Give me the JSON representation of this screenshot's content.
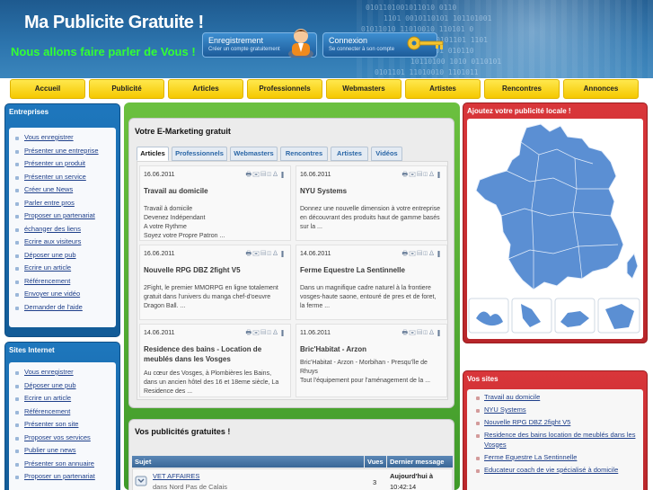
{
  "header": {
    "site_title": "Ma Publicite Gratuite !",
    "tagline": "Nous allons faire parler de Vous !",
    "register_button": {
      "label": "Enregistrement",
      "sub": "Créer un compte gratuitement"
    },
    "login_button": {
      "label": "Connexion",
      "sub": "Se connecter à son compte"
    }
  },
  "nav": [
    "Accueil",
    "Publicité",
    "Articles",
    "Professionnels",
    "Webmasters",
    "Artistes",
    "Rencontres",
    "Annonces"
  ],
  "left": {
    "entreprises": {
      "title": "Entreprises",
      "links": [
        "Vous enregistrer",
        "Présenter une entreprise",
        "Présenter un produit",
        "Présenter un service",
        "Créer une News",
        "Parler entre pros",
        "Proposer un partenariat",
        "échanger des liens",
        "Ecrire aux visiteurs",
        "Déposer une pub",
        "Ecrire un article",
        "Référencement",
        "Envoyer une vidéo",
        "Demander de l'aide"
      ]
    },
    "sites_internet": {
      "title": "Sites Internet",
      "links": [
        "Vous enregistrer",
        "Déposer une pub",
        "Ecrire un article",
        "Référencement",
        "Présenter son site",
        "Proposer vos services",
        "Publier une news",
        "Présenter son annuaire",
        "Proposer un partenariat"
      ]
    }
  },
  "emarketing": {
    "title": "Votre E-Marketing gratuit",
    "tabs": [
      "Articles",
      "Professionnels",
      "Webmasters",
      "Rencontres",
      "Artistes",
      "Vidéos"
    ],
    "articles": [
      {
        "date": "16.06.2011",
        "title": "Travail au domicile",
        "text": "Travail à domicile\nDevenez Indépendant\nA votre Rythme\nSoyez votre Propre Patron ..."
      },
      {
        "date": "16.06.2011",
        "title": "NYU Systems",
        "text": "Donnez une nouvelle dimension à votre entreprise en découvrant des produits haut de gamme basés sur la ..."
      },
      {
        "date": "16.06.2011",
        "title": "Nouvelle RPG DBZ 2fight V5",
        "text": "2Fight, le premier MMORPG en ligne totalement gratuit dans l'univers du manga chef-d'oeuvre Dragon Ball. ..."
      },
      {
        "date": "14.06.2011",
        "title": "Ferme Equestre La Sentinnelle",
        "text": "Dans un magnifique cadre naturel à la frontiere vosges-haute saone, entouré de pres et de foret, la ferme ..."
      },
      {
        "date": "14.06.2011",
        "title": "Residence des bains - Location de meublés dans les Vosges",
        "text": "Au cœur des Vosges, à Plombières les Bains, dans un ancien hôtel des 16 et 18eme siècle, La Residence des ..."
      },
      {
        "date": "11.06.2011",
        "title": "Bric'Habitat - Arzon",
        "text": "Bric'Habitat - Arzon - Morbihan - Presqu'île de Rhuys\nTout l'équipement pour l'aménagement de la ..."
      }
    ]
  },
  "publicites": {
    "title": "Vos publicités gratuites !",
    "columns": [
      "Sujet",
      "Vues",
      "Dernier message"
    ],
    "rows": [
      {
        "subject": "VET AFFAIRES",
        "location": "dans Nord Pas de Calais",
        "views": "3",
        "last": "Aujourd'hui à",
        "time": "10:42:14"
      }
    ]
  },
  "right": {
    "map_title": "Ajoutez votre publicité locale !",
    "sites_title": "Vos sites",
    "sites": [
      "Travail au domicile",
      "NYU Systems",
      "Nouvelle RPG DBZ 2fight V5",
      "Residence des bains location de meublés dans les Vosges",
      "Ferme Equestre La Sentinnelle",
      "Educateur coach de vie spécialisé à domicile"
    ]
  },
  "colors": {
    "header_blue": "#2c74ad",
    "nav_yellow": "#ffe84d",
    "left_blue": "#1e77bd",
    "center_green": "#5cb336",
    "right_red": "#d9363a",
    "map_blue": "#5b8fd3"
  }
}
